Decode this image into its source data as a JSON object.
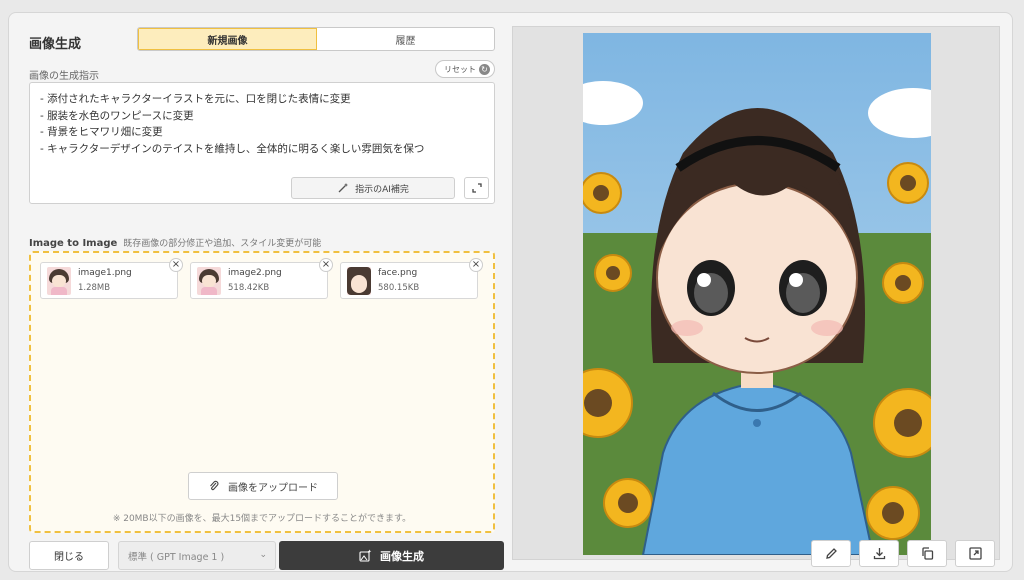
{
  "header": {
    "title": "画像生成",
    "tabs": [
      {
        "label": "新規画像",
        "active": true
      },
      {
        "label": "履歴",
        "active": false
      }
    ]
  },
  "prompt": {
    "label": "画像の生成指示",
    "reset_label": "リセット",
    "lines": [
      "- 添付されたキャラクターイラストを元に、口を閉じた表情に変更",
      "- 服装を水色のワンピースに変更",
      "- 背景をヒマワリ畑に変更",
      "- キャラクターデザインのテイストを維持し、全体的に明るく楽しい雰囲気を保つ"
    ],
    "ai_assist_label": "指示のAI補完"
  },
  "image_to_image": {
    "title": "Image to Image",
    "description": "既存画像の部分修正や追加、スタイル変更が可能",
    "files": [
      {
        "name": "image1.png",
        "size": "1.28MB"
      },
      {
        "name": "image2.png",
        "size": "518.42KB"
      },
      {
        "name": "face.png",
        "size": "580.15KB"
      }
    ],
    "upload_label": "画像をアップロード",
    "upload_note": "※ 20MB以下の画像を、最大15個までアップロードすることができます。"
  },
  "footer": {
    "close_label": "閉じる",
    "model_value": "標準 ( GPT Image 1 )",
    "generate_label": "画像生成"
  },
  "colors": {
    "accent": "#f0c040",
    "accent_bg": "#fdedbd",
    "primary_button": "#3c3c3c"
  },
  "icons": {
    "reset": "refresh-icon",
    "ai_assist": "magic-wand-icon",
    "expand": "expand-icon",
    "upload": "paperclip-icon",
    "generate": "image-sparkle-icon",
    "tools": [
      "edit-icon",
      "download-icon",
      "copy-icon",
      "open-external-icon"
    ]
  }
}
